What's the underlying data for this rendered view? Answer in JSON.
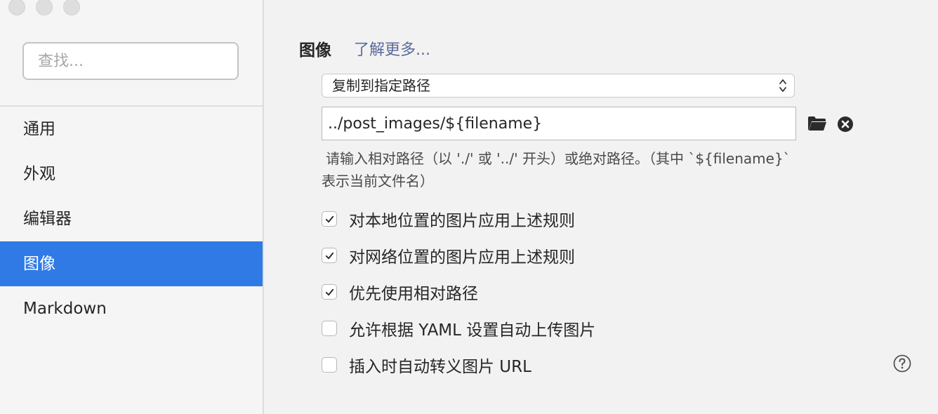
{
  "sidebar": {
    "search_placeholder": "查找...",
    "items": [
      {
        "label": "通用",
        "active": false
      },
      {
        "label": "外观",
        "active": false
      },
      {
        "label": "编辑器",
        "active": false
      },
      {
        "label": "图像",
        "active": true
      },
      {
        "label": "Markdown",
        "active": false
      }
    ]
  },
  "main": {
    "section_title": "图像",
    "learn_more": "了解更多...",
    "action_select": {
      "selected": "复制到指定路径"
    },
    "path_input": {
      "value": "../post_images/${filename}"
    },
    "hint": {
      "line1": "请输入相对路径（以 './' 或 '../' 开头）或绝对路径。（其中 `${filename}`",
      "line2": "表示当前文件名）"
    },
    "options": [
      {
        "label": "对本地位置的图片应用上述规则",
        "checked": true
      },
      {
        "label": "对网络位置的图片应用上述规则",
        "checked": true
      },
      {
        "label": "优先使用相对路径",
        "checked": true
      },
      {
        "label": "允许根据 YAML 设置自动上传图片",
        "checked": false
      },
      {
        "label": "插入时自动转义图片 URL",
        "checked": false
      }
    ]
  },
  "icons": {
    "folder": "folder-icon",
    "clear": "clear-circle-icon",
    "help": "help-circle-icon",
    "select_arrows": "up-down-chevron-icon",
    "check": "checkmark-icon"
  },
  "colors": {
    "accent": "#2f7ae5",
    "link": "#5a6a9c"
  }
}
